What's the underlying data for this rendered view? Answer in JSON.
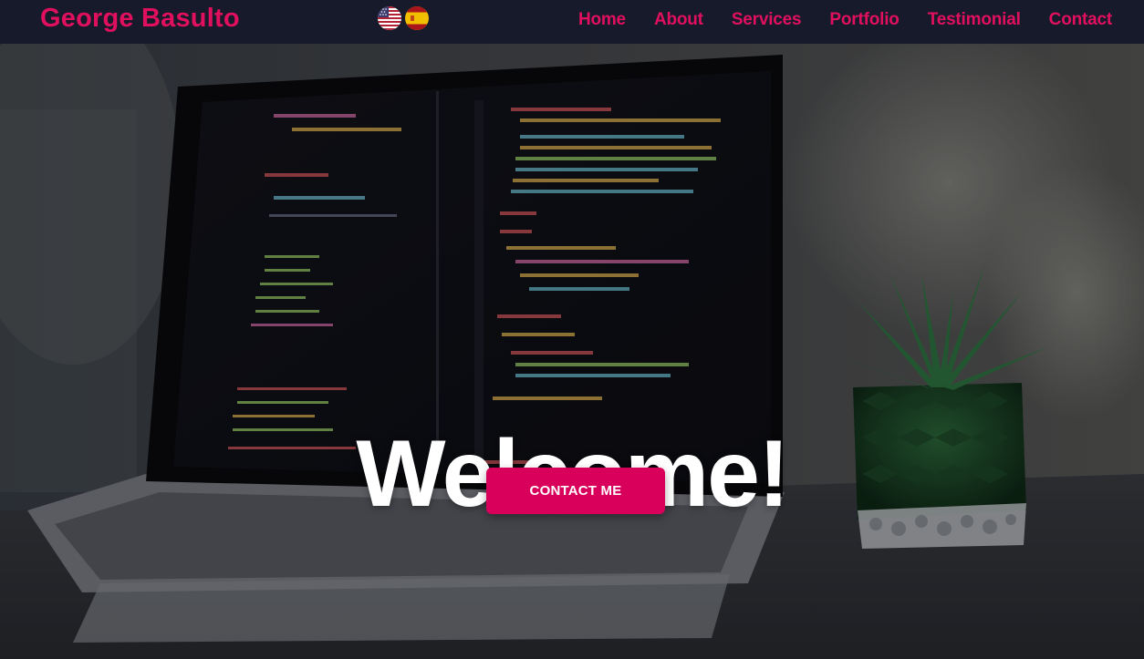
{
  "navbar": {
    "brand": "George Basulto",
    "flags": [
      {
        "icon": "us-flag-icon",
        "lang": "English"
      },
      {
        "icon": "spain-flag-icon",
        "lang": "Español"
      }
    ],
    "links": [
      {
        "label": "Home"
      },
      {
        "label": "About"
      },
      {
        "label": "Services"
      },
      {
        "label": "Portfolio"
      },
      {
        "label": "Testimonial"
      },
      {
        "label": "Contact"
      }
    ]
  },
  "hero": {
    "title": "Welcome!",
    "cta_label": "CONTACT ME",
    "background": "laptop-with-code-and-plant-photo"
  },
  "colors": {
    "accent": "#e0105f",
    "button": "#d9005b",
    "navbar_bg": "#161a2a",
    "title_text": "#ffffff"
  }
}
